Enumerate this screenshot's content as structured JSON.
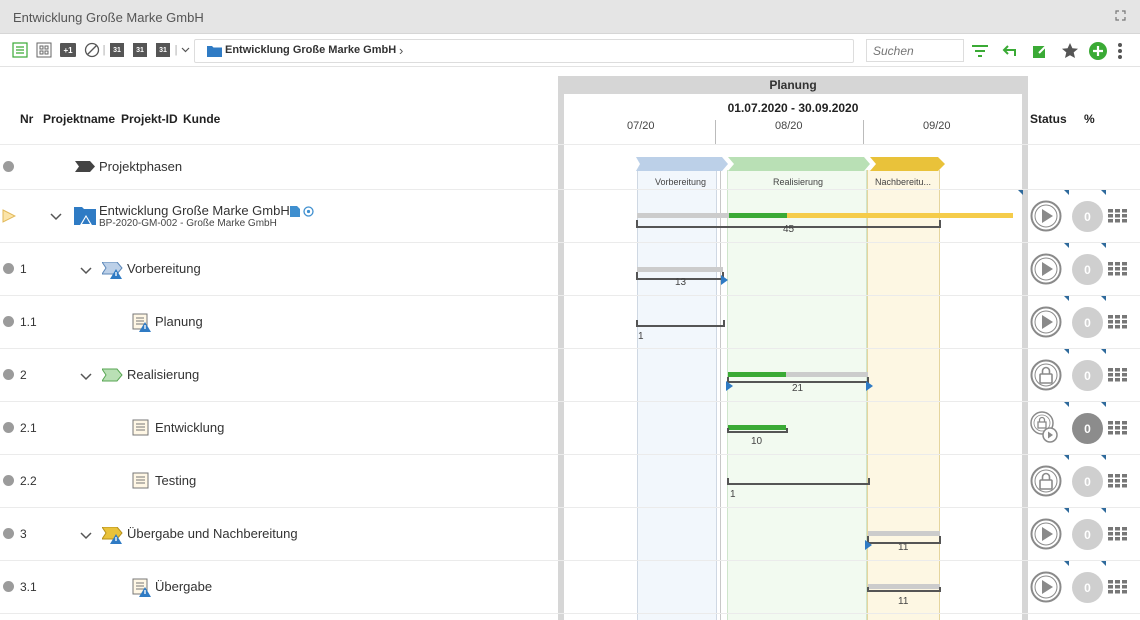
{
  "window": {
    "title": "Entwicklung Große Marke GmbH"
  },
  "toolbar": {
    "breadcrumb": "Entwicklung Große Marke GmbH",
    "search_placeholder": "Suchen",
    "icon_plus_one": "+1",
    "icon_cal1": "31",
    "icon_cal2": "31",
    "icon_cal3": "31"
  },
  "columns": {
    "nr": "Nr",
    "projektname": "Projektname",
    "projekt_id": "Projekt-ID",
    "kunde": "Kunde",
    "status": "Status",
    "percent": "%"
  },
  "planning": {
    "title": "Planung",
    "range": "01.07.2020 - 30.09.2020",
    "months": [
      "07/20",
      "08/20",
      "09/20"
    ],
    "phases": [
      "Vorbereitung",
      "Realisierung",
      "Nachbereitu..."
    ],
    "phase_colors": [
      "#bcd0e8",
      "#b9e0b5",
      "#e9c23a"
    ]
  },
  "rows": [
    {
      "nr": "",
      "name": "Projektphasen"
    },
    {
      "nr": "",
      "name": "Entwicklung Große Marke GmbH",
      "sub": "BP-2020-GM-002 - Große Marke GmbH",
      "bar_label": "45",
      "pct": "0"
    },
    {
      "nr": "1",
      "name": "Vorbereitung",
      "bar_label": "13",
      "pct": "0"
    },
    {
      "nr": "1.1",
      "name": "Planung",
      "bar_label": "1",
      "pct": "0"
    },
    {
      "nr": "2",
      "name": "Realisierung",
      "bar_label": "21",
      "pct": "0"
    },
    {
      "nr": "2.1",
      "name": "Entwicklung",
      "bar_label": "10",
      "pct": "0"
    },
    {
      "nr": "2.2",
      "name": "Testing",
      "bar_label": "1",
      "pct": "0"
    },
    {
      "nr": "3",
      "name": "Übergabe und Nachbereitung",
      "bar_label": "11",
      "pct": "0"
    },
    {
      "nr": "3.1",
      "name": "Übergabe",
      "bar_label": "11",
      "pct": "0"
    }
  ],
  "icons": [
    "list-view-icon",
    "tile-view-icon",
    "plus-one-icon",
    "no-percent-icon",
    "calendar-icon",
    "filter-icon",
    "undo-icon",
    "edit-icon",
    "star-icon",
    "add-icon",
    "more-icon",
    "play-icon",
    "lock-icon",
    "grid-icon",
    "folder-icon",
    "task-icon",
    "warning-icon"
  ],
  "colors": {
    "accent_green": "#3aaa35",
    "accent_blue": "#2f7bc4",
    "progress_yellow": "#f5cc4a",
    "status_grey": "#8a8a8a"
  }
}
